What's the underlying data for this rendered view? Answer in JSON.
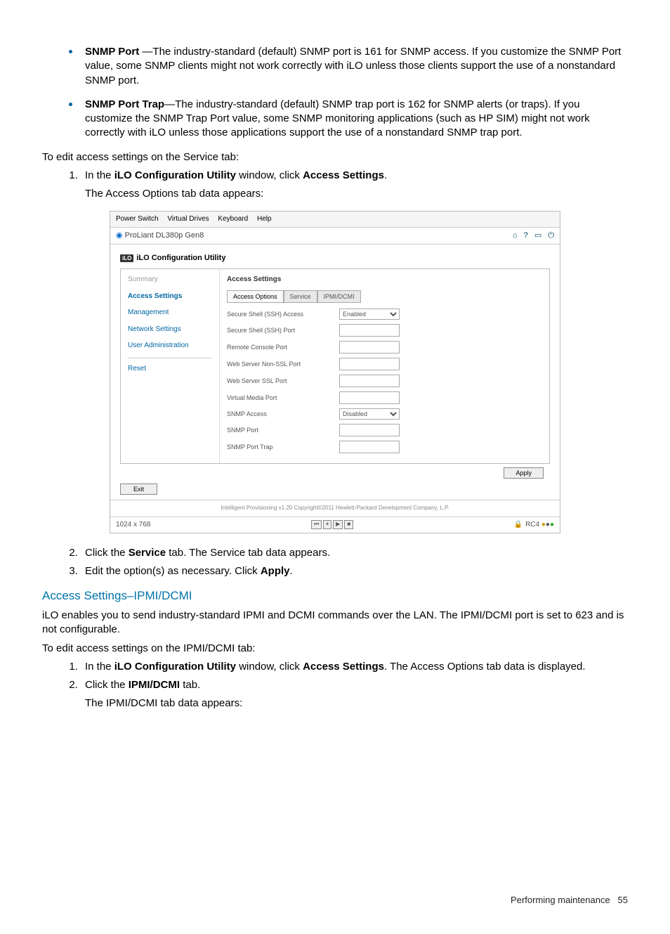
{
  "bullets": [
    {
      "term": "SNMP Port",
      "sep": " —",
      "text": "The industry-standard (default) SNMP port is 161 for SNMP access. If you customize the SNMP Port value, some SNMP clients might not work correctly with iLO unless those clients support the use of a nonstandard SNMP port."
    },
    {
      "term": "SNMP Port Trap",
      "sep": "—",
      "text": "The industry-standard (default) SNMP trap port is 162 for SNMP alerts (or traps). If you customize the SNMP Trap Port value, some SNMP monitoring applications (such as HP SIM) might not work correctly with iLO unless those applications support the use of a nonstandard SNMP trap port."
    }
  ],
  "intro1": "To edit access settings on the Service tab:",
  "step1": {
    "pre": "In the ",
    "b1": "iLO Configuration Utility",
    "mid": " window, click ",
    "b2": "Access Settings",
    "post": "."
  },
  "sub1": "The Access Options tab data appears:",
  "ss": {
    "menubar": [
      "Power Switch",
      "Virtual Drives",
      "Keyboard",
      "Help"
    ],
    "product": "ProLiant DL380p Gen8",
    "util_title": "iLO Configuration Utility",
    "side": [
      "Summary",
      "Access Settings",
      "Management",
      "Network Settings",
      "User Administration",
      "Reset"
    ],
    "panel_title": "Access Settings",
    "tabs": [
      "Access Options",
      "Service",
      "IPMI/DCMI"
    ],
    "rows": [
      {
        "label": "Secure Shell (SSH) Access",
        "type": "select",
        "value": "Enabled"
      },
      {
        "label": "Secure Shell (SSH) Port",
        "type": "input",
        "value": ""
      },
      {
        "label": "Remote Console Port",
        "type": "input",
        "value": ""
      },
      {
        "label": "Web Server Non-SSL Port",
        "type": "input",
        "value": ""
      },
      {
        "label": "Web Server SSL Port",
        "type": "input",
        "value": ""
      },
      {
        "label": "Virtual Media Port",
        "type": "input",
        "value": ""
      },
      {
        "label": "SNMP Access",
        "type": "select",
        "value": "Disabled"
      },
      {
        "label": "SNMP Port",
        "type": "input",
        "value": ""
      },
      {
        "label": "SNMP Port Trap",
        "type": "input",
        "value": ""
      }
    ],
    "apply": "Apply",
    "exit": "Exit",
    "copyright": "Intelligent Provisioning v1.20 Copyright©2011 Hewlett-Packard Development Company, L.P.",
    "resolution": "1024 x 768",
    "rc": "RC4"
  },
  "step2": {
    "pre": "Click the ",
    "b": "Service",
    "post": " tab. The Service tab data appears."
  },
  "step3": {
    "pre": "Edit the option(s) as necessary. Click ",
    "b": "Apply",
    "post": "."
  },
  "section_head": "Access Settings–IPMI/DCMI",
  "para1": "iLO enables you to send industry-standard IPMI and DCMI commands over the LAN. The IPMI/DCMI port is set to 623 and is not configurable.",
  "intro2": "To edit access settings on the IPMI/DCMI tab:",
  "step1b": {
    "pre": "In the ",
    "b1": "iLO Configuration Utility",
    "mid": " window, click ",
    "b2": "Access Settings",
    "post": ". The Access Options tab data is displayed."
  },
  "step2b": {
    "pre": "Click the ",
    "b": "IPMI/DCMI",
    "post": " tab."
  },
  "sub2": "The IPMI/DCMI tab data appears:",
  "footer_text": "Performing maintenance",
  "footer_page": "55"
}
